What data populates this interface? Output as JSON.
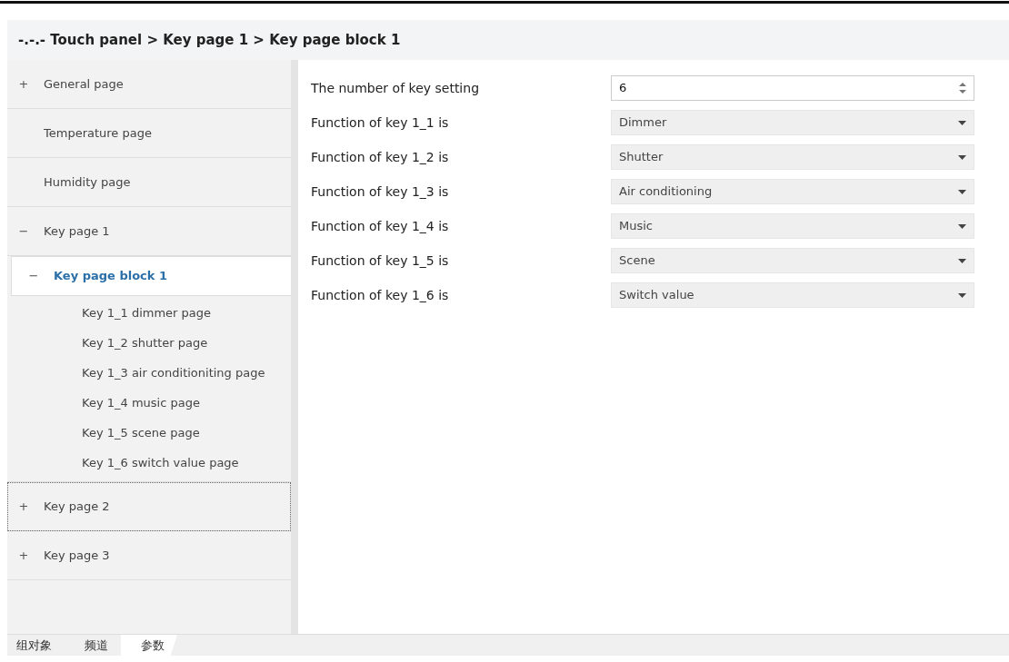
{
  "breadcrumb": "-.-.- Touch panel > Key page 1 > Key page block 1",
  "sidebar": {
    "items": [
      {
        "label": "General page",
        "expander": "+",
        "selected": false,
        "focused": false
      },
      {
        "label": "Temperature page",
        "selected": false,
        "focused": false
      },
      {
        "label": "Humidity page",
        "selected": false,
        "focused": false
      },
      {
        "label": "Key page 1",
        "expander": "−",
        "selected": false,
        "focused": false,
        "children": [
          {
            "label": "Key page block 1",
            "expander": "−",
            "selected": true,
            "focused": false,
            "children": [
              {
                "label": "Key 1_1 dimmer page",
                "selected": false,
                "focused": false
              },
              {
                "label": "Key 1_2 shutter page",
                "selected": false,
                "focused": false
              },
              {
                "label": "Key 1_3 air conditioniting page",
                "selected": false,
                "focused": false
              },
              {
                "label": "Key 1_4 music page",
                "selected": false,
                "focused": false
              },
              {
                "label": "Key 1_5 scene page",
                "selected": false,
                "focused": false
              },
              {
                "label": "Key 1_6 switch value page",
                "selected": false,
                "focused": false
              }
            ]
          }
        ]
      },
      {
        "label": "Key page 2",
        "expander": "+",
        "selected": false,
        "focused": true
      },
      {
        "label": "Key page 3",
        "expander": "+",
        "selected": false,
        "focused": false
      }
    ]
  },
  "parameters": [
    {
      "label": "The number of key setting",
      "kind": "spinner",
      "value": "6"
    },
    {
      "label": "Function of key 1_1 is",
      "kind": "dropdown",
      "value": "Dimmer"
    },
    {
      "label": "Function of key 1_2 is",
      "kind": "dropdown",
      "value": "Shutter"
    },
    {
      "label": "Function of key 1_3 is",
      "kind": "dropdown",
      "value": "Air conditioning"
    },
    {
      "label": "Function of key 1_4 is",
      "kind": "dropdown",
      "value": "Music"
    },
    {
      "label": "Function of key 1_5 is",
      "kind": "dropdown",
      "value": "Scene"
    },
    {
      "label": "Function of key 1_6 is",
      "kind": "dropdown",
      "value": "Switch value"
    }
  ],
  "tabs": [
    {
      "label": "组对象",
      "selected": false
    },
    {
      "label": "频道",
      "selected": false
    },
    {
      "label": "参数",
      "selected": true
    }
  ]
}
